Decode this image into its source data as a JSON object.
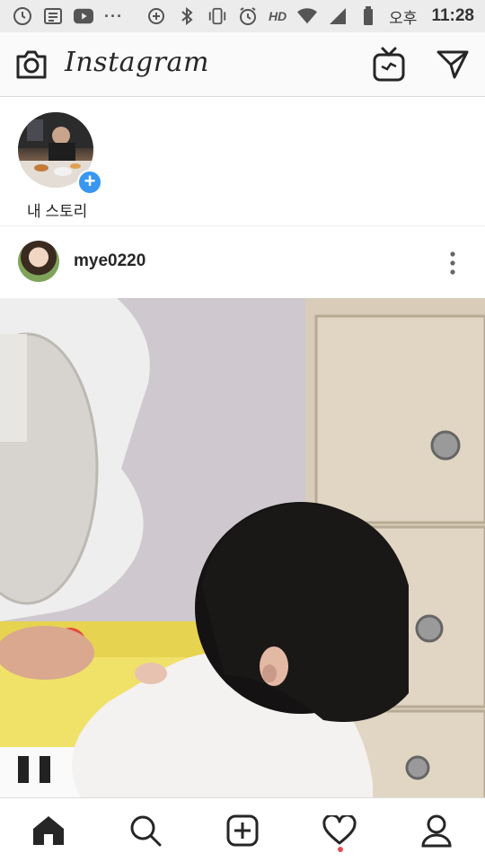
{
  "status_bar": {
    "ampm": "오후",
    "time": "11:28",
    "hd": "HD",
    "more": "···",
    "icons": [
      "alarm-clock-icon",
      "news-icon",
      "youtube-icon",
      "more-icon",
      "data-saver-icon",
      "bluetooth-icon",
      "vibrate-icon",
      "alarm-icon",
      "hd-icon",
      "wifi-icon",
      "signal-icon",
      "battery-icon"
    ]
  },
  "header": {
    "logo": "Instagram",
    "icons": [
      "camera-icon",
      "igtv-icon",
      "direct-send-icon"
    ]
  },
  "stories": {
    "items": [
      {
        "label": "내 스토리"
      }
    ]
  },
  "post": {
    "username": "mye0220"
  },
  "bottom_nav": {
    "items": [
      "home-icon",
      "search-icon",
      "add-post-icon",
      "activity-heart-icon",
      "profile-icon"
    ],
    "active": "home-icon",
    "notification_dot_color": "#ed4956"
  },
  "colors": {
    "accent_blue": "#3897f0",
    "text": "#262626",
    "border": "#dbdbdb"
  }
}
